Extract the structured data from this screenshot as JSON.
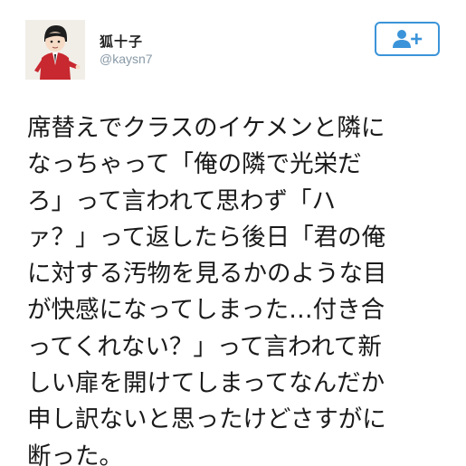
{
  "user": {
    "display_name": "狐十子",
    "username": "@kaysn7",
    "avatar_icon": "character-avatar-icon"
  },
  "follow_button": {
    "icon": "add-user-icon",
    "color": "#3b94d9"
  },
  "tweet": {
    "text": "席替えでクラスのイケメンと隣に\nなっちゃって「俺の隣で光栄だ\nろ」って言われて思わず「ハ\nァ？」って返したら後日「君の俺\nに対する汚物を見るかのような目\nが快感になってしまった…付き合\nってくれない？」って言われて新\nしい扉を開けてしまってなんだか\n申し訳ないと思ったけどさすがに\n断った。"
  }
}
